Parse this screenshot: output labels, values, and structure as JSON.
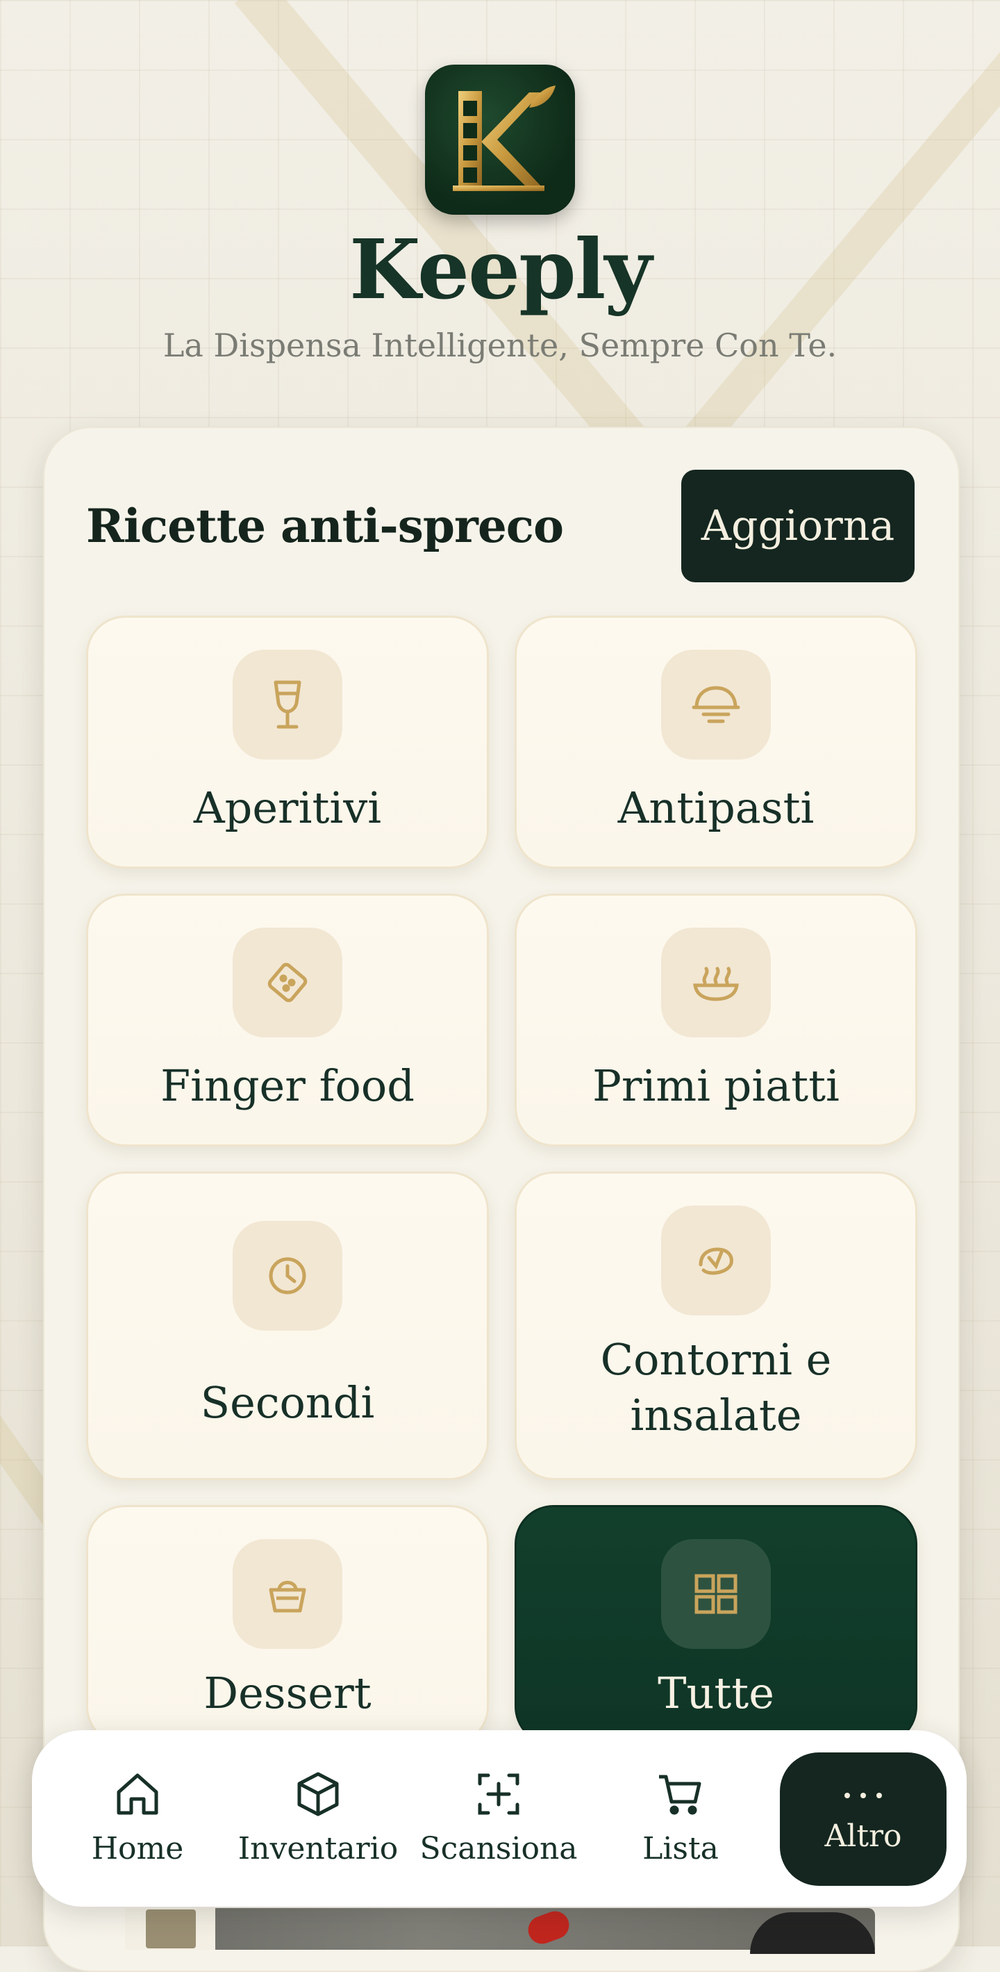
{
  "app": {
    "name": "Keeply",
    "tagline": "La Dispensa Intelligente, Sempre Con Te."
  },
  "recipes": {
    "title": "Ricette anti-spreco",
    "refresh_label": "Aggiorna",
    "categories": [
      {
        "label": "Aperitivi",
        "icon": "wine-glass-icon"
      },
      {
        "label": "Antipasti",
        "icon": "cloche-icon"
      },
      {
        "label": "Finger food",
        "icon": "cracker-icon"
      },
      {
        "label": "Primi piatti",
        "icon": "pasta-bowl-icon"
      },
      {
        "label": "Secondi",
        "icon": "clock-icon"
      },
      {
        "label": "Contorni e insalate",
        "icon": "leaf-icon"
      },
      {
        "label": "Dessert",
        "icon": "basket-icon"
      },
      {
        "label": "Tutte",
        "icon": "grid-icon",
        "selected": true
      }
    ]
  },
  "nav": {
    "items": [
      {
        "label": "Home",
        "icon": "home-icon"
      },
      {
        "label": "Inventario",
        "icon": "box-icon"
      },
      {
        "label": "Scansiona",
        "icon": "scan-icon"
      },
      {
        "label": "Lista",
        "icon": "cart-icon"
      },
      {
        "label": "Altro",
        "icon": "more-icon",
        "active": true
      }
    ]
  },
  "colors": {
    "primary_dark": "#14261f",
    "accent_gold": "#c9a45c",
    "card_bg": "#fcf8ee",
    "active_card": "#123f2c"
  }
}
